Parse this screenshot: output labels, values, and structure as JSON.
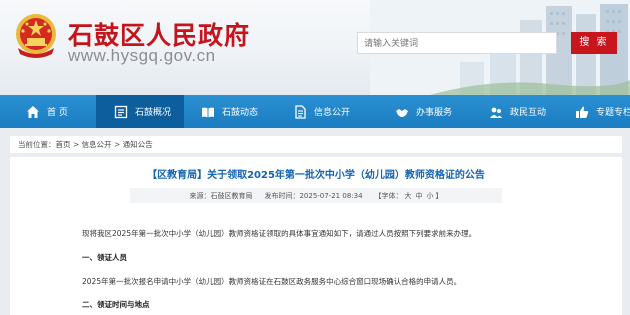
{
  "header": {
    "site_name": "石鼓区人民政府",
    "site_url": "www.hysgq.gov.cn",
    "search_placeholder": "请输入关键词",
    "search_button": "搜 索"
  },
  "nav": {
    "items": [
      {
        "label": "首 页",
        "icon": "home-icon"
      },
      {
        "label": "石鼓概况",
        "icon": "overview-icon"
      },
      {
        "label": "石鼓动态",
        "icon": "book-icon"
      },
      {
        "label": "信息公开",
        "icon": "document-icon"
      },
      {
        "label": "办事服务",
        "icon": "handshake-icon"
      },
      {
        "label": "政民互动",
        "icon": "interaction-icon"
      },
      {
        "label": "专题专栏",
        "icon": "thumbs-up-icon"
      }
    ],
    "active_index": 1
  },
  "breadcrumb": {
    "prefix": "当前位置：",
    "items": [
      "首页",
      "信息公开",
      "通知公告"
    ],
    "separator": " > "
  },
  "article": {
    "title": "【区教育局】关于领取2025年第一批次中小学（幼儿园）教师资格证的公告",
    "source_label": "来源：",
    "source_value": "石鼓区教育局",
    "date_label": "发布时间：",
    "date_value": "2025-07-21 08:34",
    "font_label": "【字体：",
    "font_large": "大",
    "font_medium": "中",
    "font_small": "小",
    "font_end": "】",
    "paragraphs": [
      "现将我区2025年第一批次中小学（幼儿园）教师资格证领取的具体事宜通知如下，请通过人员按照下列要求前来办理。",
      "一、领证人员",
      "2025年第一批次报名申请中小学（幼儿园）教师资格证在石鼓区政务服务中心综合窗口现场确认合格的申请人员。",
      "二、领证时间与地点"
    ]
  },
  "colors": {
    "brand_red": "#c4151c",
    "nav_blue": "#1b7cc0",
    "nav_active": "#0d5e9c",
    "title_blue": "#1364b3"
  }
}
